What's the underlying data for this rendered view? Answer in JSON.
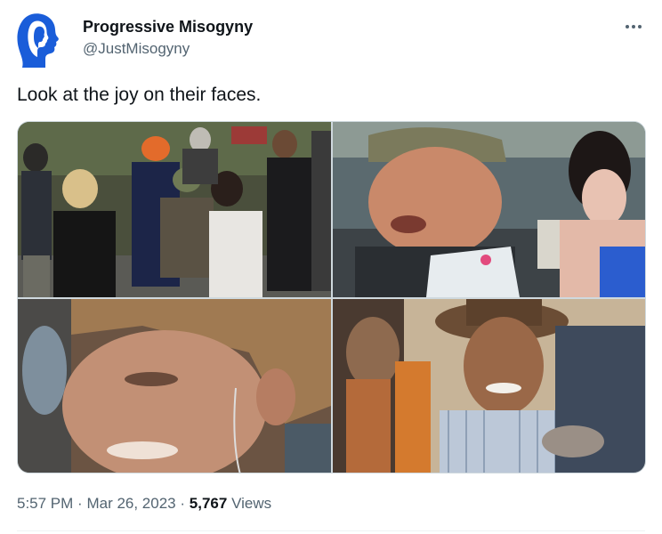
{
  "author": {
    "display_name": "Progressive Misogyny",
    "handle": "@JustMisogyny",
    "avatar_icon": "profile-faces-logo-icon",
    "avatar_color": "#1a5dd9"
  },
  "tweet": {
    "text": "Look at the joy on their faces."
  },
  "more_icon": "ellipsis-icon",
  "meta": {
    "time": "5:57 PM",
    "dot1": "·",
    "date": "Mar 26, 2023",
    "dot2": "·",
    "views_count": "5,767",
    "views_label": "Views"
  },
  "media": {
    "photos": [
      {
        "name": "photo-crowd-protest"
      },
      {
        "name": "photo-man-shouting-megaphone"
      },
      {
        "name": "photo-blond-person-closeup"
      },
      {
        "name": "photo-smiling-man-hat"
      }
    ]
  }
}
